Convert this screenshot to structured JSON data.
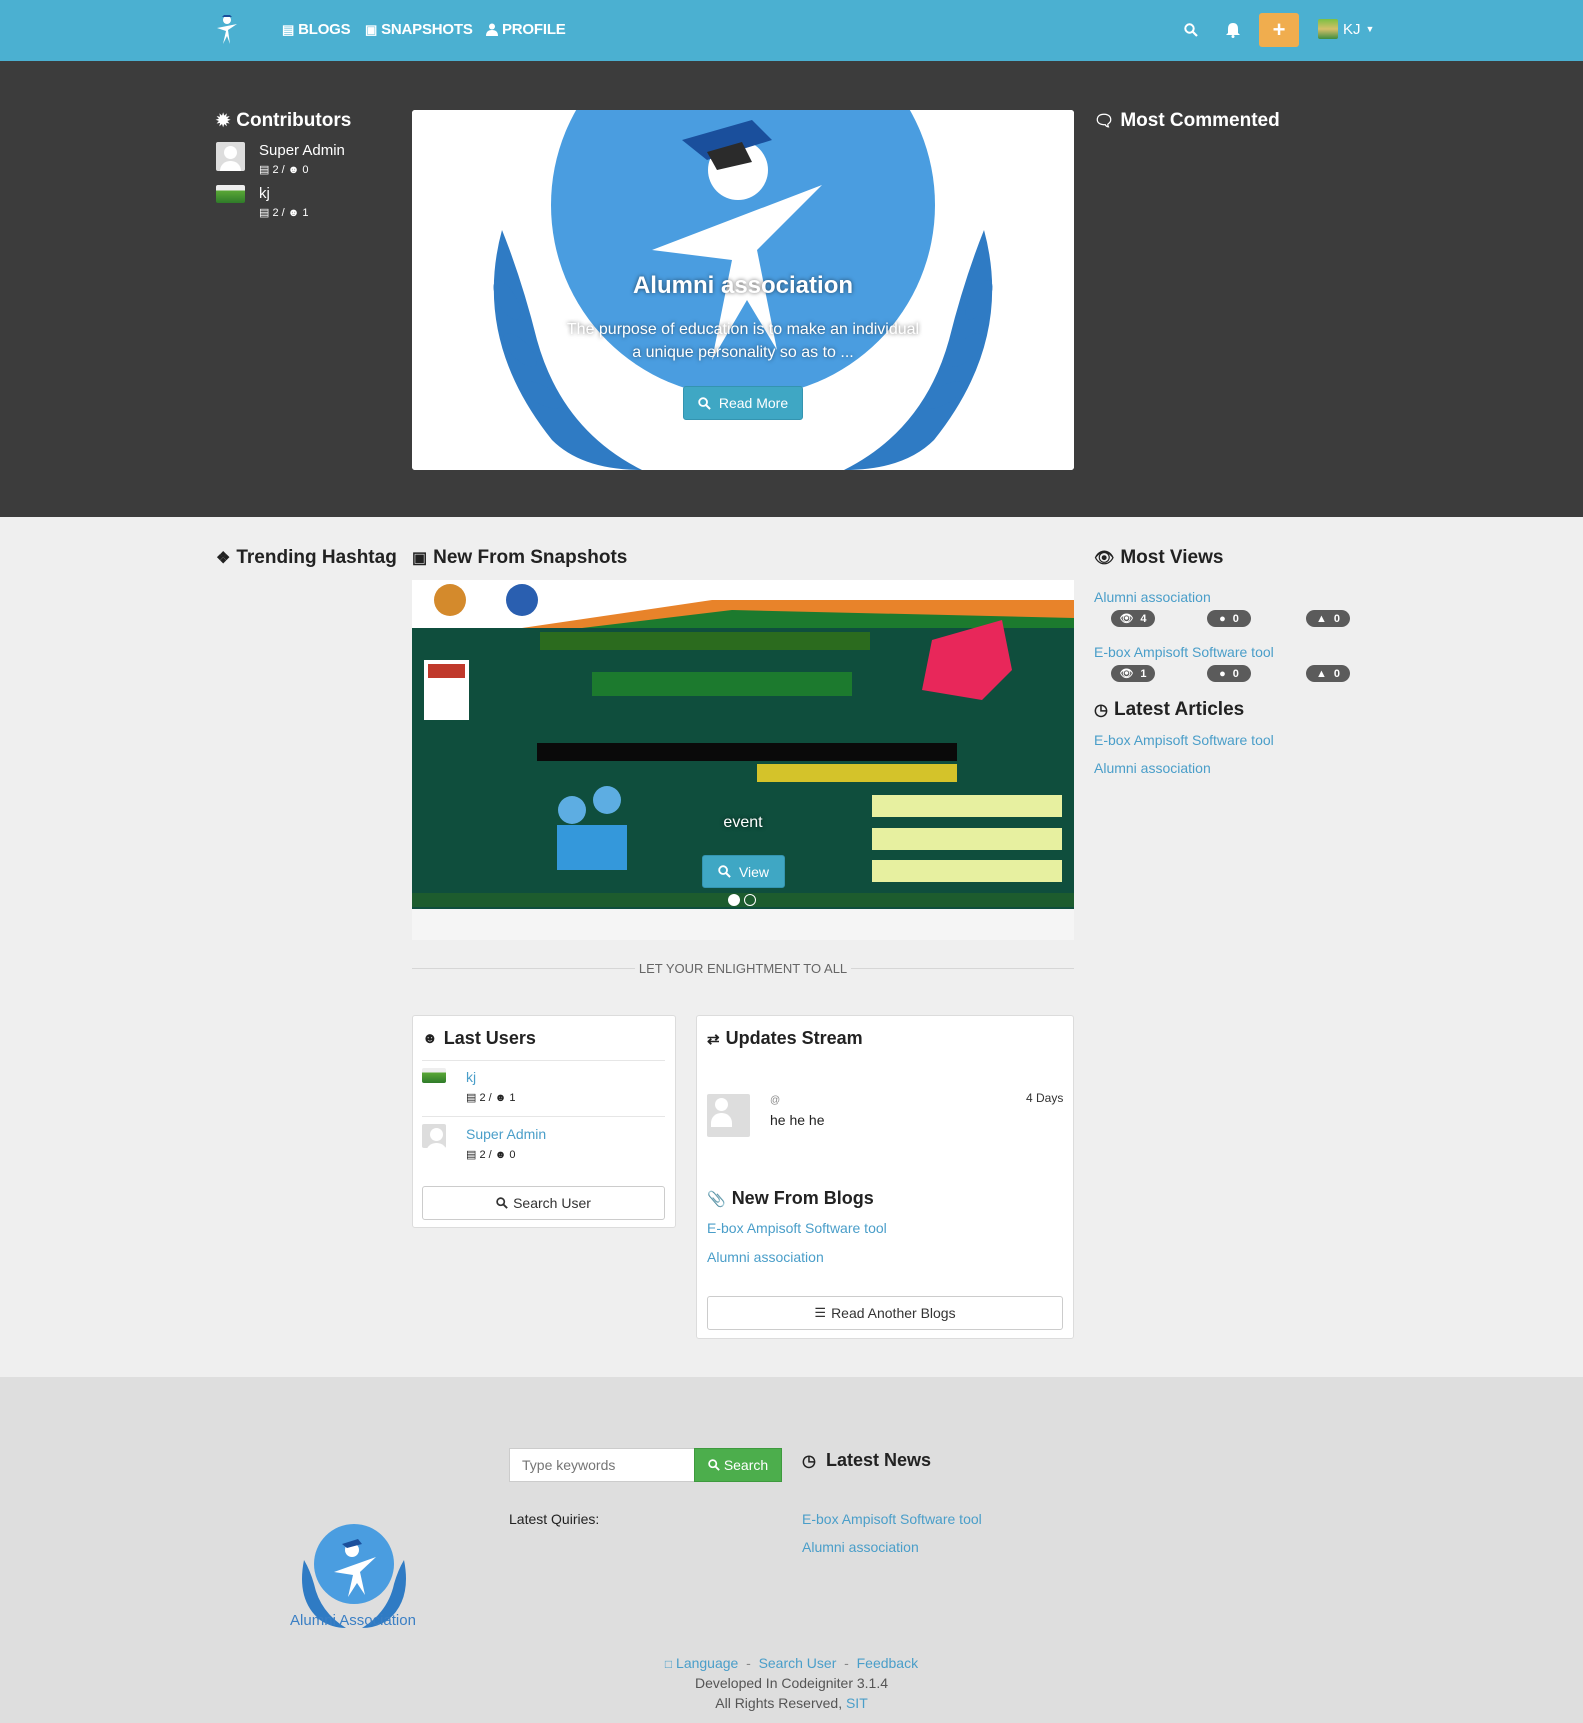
{
  "nav": {
    "blogs": "BLOGS",
    "snapshots": "SNAPSHOTS",
    "profile": "PROFILE",
    "plus": "+",
    "user": "KJ"
  },
  "contributors": {
    "title": "Contributors",
    "items": [
      {
        "name": "Super Admin",
        "posts": "2",
        "friends": "0"
      },
      {
        "name": "kj",
        "posts": "2",
        "friends": "1"
      }
    ]
  },
  "hero": {
    "title": "Alumni association",
    "desc_line1": "The purpose of education is to make an individual",
    "desc_line2": "a unique personality so as to ...",
    "button": "Read More"
  },
  "most_commented": {
    "title": "Most Commented"
  },
  "trending": {
    "title": "Trending Hashtag"
  },
  "snapshots": {
    "title": "New From Snapshots",
    "caption": "event",
    "button": "View"
  },
  "divider": "LET YOUR ENLIGHTMENT TO ALL",
  "most_views": {
    "title": "Most Views",
    "items": [
      {
        "title": "Alumni association",
        "views": "4",
        "comments": "0",
        "likes": "0"
      },
      {
        "title": "E-box Ampisoft Software tool",
        "views": "1",
        "comments": "0",
        "likes": "0"
      }
    ]
  },
  "latest_articles": {
    "title": "Latest Articles",
    "items": [
      "E-box Ampisoft Software tool",
      "Alumni association"
    ]
  },
  "last_users": {
    "title": "Last Users",
    "items": [
      {
        "name": "kj",
        "posts": "2",
        "friends": "1"
      },
      {
        "name": "Super Admin",
        "posts": "2",
        "friends": "0"
      }
    ],
    "button": "Search User"
  },
  "updates": {
    "title": "Updates Stream",
    "handle": "@",
    "time": "4 Days",
    "text": "he he he"
  },
  "new_blogs": {
    "title": "New From Blogs",
    "items": [
      "E-box Ampisoft Software tool",
      "Alumni association"
    ],
    "button": "Read Another Blogs"
  },
  "footer": {
    "logo_text": "Alumni Association",
    "search_placeholder": "Type keywords",
    "search_button": "Search",
    "latest_queries": "Latest Quiries:",
    "latest_news_title": "Latest News",
    "news": [
      "E-box Ampisoft Software tool",
      "Alumni association"
    ],
    "link_language": "Language",
    "link_search_user": "Search User",
    "link_feedback": "Feedback",
    "sep": "-",
    "developed": "Developed In Codeigniter 3.1.4",
    "rights": "All Rights Reserved,",
    "rights_link": "SIT"
  },
  "colors": {
    "navbar": "#4bb0d1",
    "dark": "#3c3c3c",
    "accent": "#4a9ec9",
    "orange": "#f0ad4e",
    "green": "#4cae4c"
  }
}
